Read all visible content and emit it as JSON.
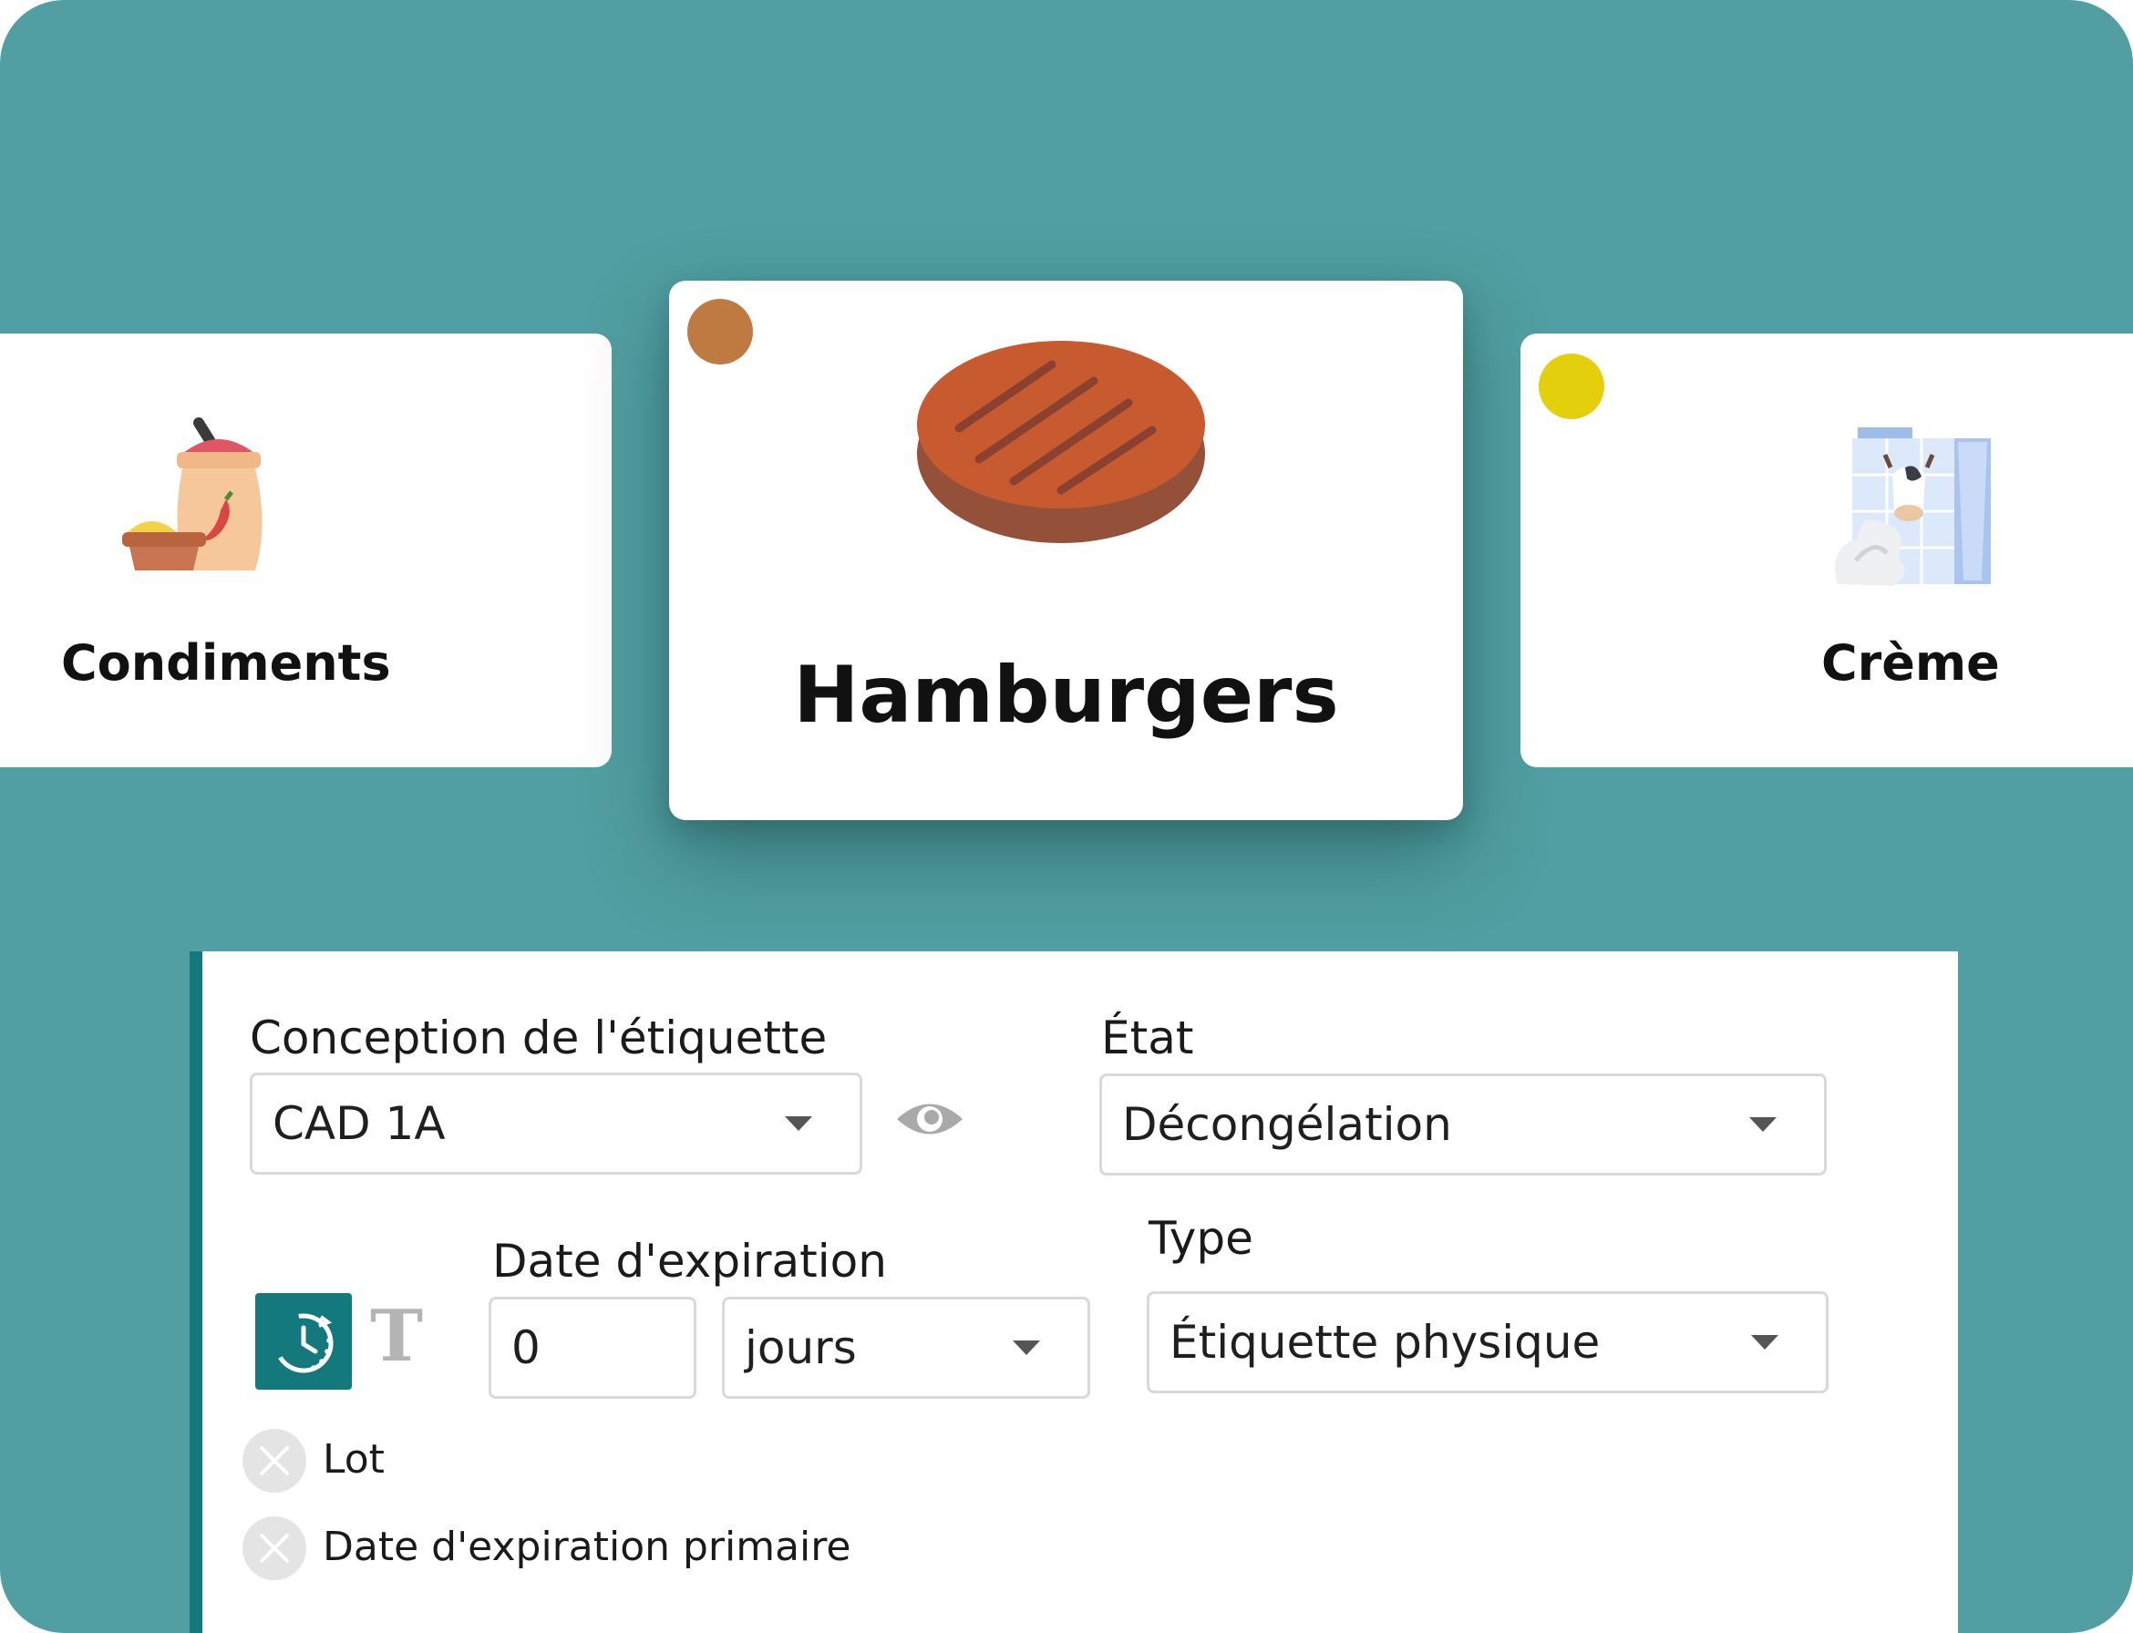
{
  "categories": {
    "left": {
      "title": "Condiments",
      "icon": "condiments-sack-icon"
    },
    "center": {
      "title": "Hamburgers",
      "icon": "hamburger-patty-icon",
      "dot_color": "#bf7a42"
    },
    "right": {
      "title": "Crème",
      "icon": "cream-carton-icon",
      "dot_color": "#e3cf0b"
    }
  },
  "form": {
    "label_design": {
      "label": "Conception de l'étiquette",
      "value": "CAD 1A"
    },
    "state": {
      "label": "État",
      "value": "Décongélation"
    },
    "expiration": {
      "label": "Date d'expiration",
      "amount": "0",
      "unit": "jours"
    },
    "type": {
      "label": "Type",
      "value": "Étiquette physique"
    },
    "options": [
      {
        "label": "Lot"
      },
      {
        "label": "Date d'expiration primaire"
      }
    ]
  },
  "colors": {
    "background": "#519fa2",
    "accent": "#14797c"
  }
}
